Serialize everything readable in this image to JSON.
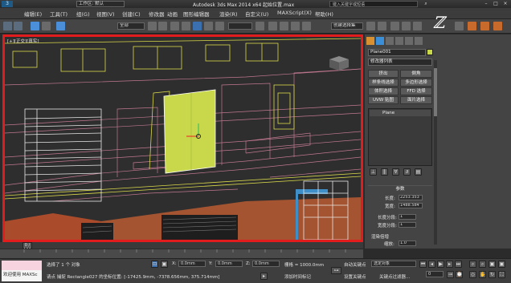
{
  "window": {
    "title": "Autodesk 3ds Max 2014 x64      起始位置.max",
    "app_logo": "3",
    "search_placeholder": "键入关键字或短语"
  },
  "menu": [
    "编辑(E)",
    "工具(T)",
    "组(G)",
    "视图(V)",
    "创建(C)",
    "修改器",
    "动画",
    "图形编辑器",
    "渲染(R)",
    "自定义(U)",
    "MAXScript(X)",
    "帮助(H)"
  ],
  "toolbar": {
    "workspace_label": "工作区: 默认",
    "selection_filter": "全部",
    "selection_set": "创建选择集"
  },
  "viewport": {
    "label": "[+][正交][真实]"
  },
  "command_panel": {
    "object_name": "Plane001",
    "modifier_list": "修改器列表",
    "buttons": [
      "挤出",
      "倒角",
      "样条线选择",
      "多边形选择",
      "体积选择",
      "FFD 选择",
      "UVW 贴图",
      "面片选择"
    ],
    "stack_item": "Plane",
    "params_title": "参数",
    "length_label": "长度:",
    "length_value": "2253.353",
    "width_label": "宽度:",
    "width_value": "1488.584",
    "length_segs_label": "长度分段:",
    "length_segs_value": "1",
    "width_segs_label": "宽度分段:",
    "width_segs_value": "1",
    "render_mult_label": "渲染倍增",
    "scale_label": "缩放:",
    "scale_value": "1.0",
    "density_label": "密度:",
    "density_value": "1.0"
  },
  "timeline": {
    "knob": "0 / 100",
    "ticks": [
      "0",
      "5",
      "10",
      "15",
      "20",
      "25",
      "30",
      "35",
      "40",
      "45",
      "50",
      "55",
      "60",
      "65",
      "70",
      "75",
      "80",
      "85",
      "90",
      "95",
      "100"
    ]
  },
  "status": {
    "maxscript_hint": "欢迎使用 MAXSc",
    "selected": "选择了 1 个 对象",
    "prompt": "请点 捕捉 Rectangle027 的坐标位置: [-17425.9mm, -7378.656mm, 375.714mm]",
    "x_label": "X:",
    "x_value": "0.0mm",
    "y_label": "Y:",
    "y_value": "0.0mm",
    "z_label": "Z:",
    "z_value": "0.0mm",
    "grid": "栅格 = 1000.0mm",
    "add_time_tag": "添加时间标记",
    "auto_key": "自动关键点",
    "set_key": "设置关键点",
    "selected_obj": "选定对象",
    "key_filters": "关键点过滤器...",
    "frame": "0"
  },
  "colors": {
    "highlight_border": "#e21c1c",
    "plane_yellow": "#c8d84a",
    "wire_pink": "#c07890",
    "wire_yellow": "#d8d84a",
    "orange_wall": "#c0502c"
  }
}
